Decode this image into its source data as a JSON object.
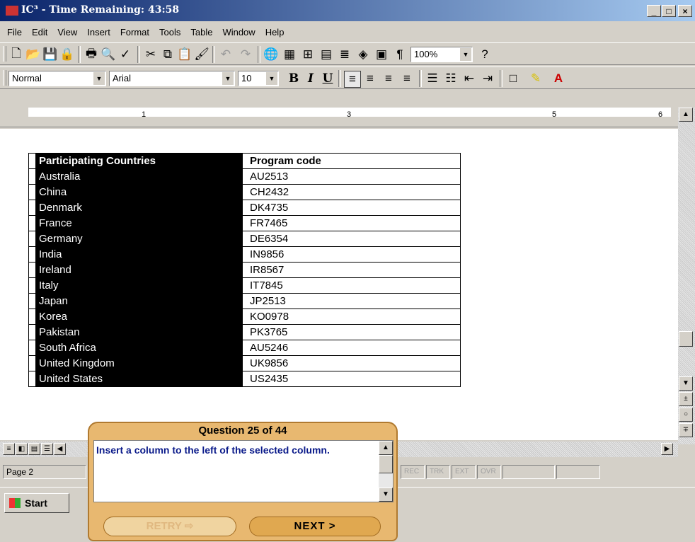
{
  "window": {
    "title": "IC³ - Time Remaining:  43:58",
    "controls": [
      "_",
      "□",
      "×"
    ]
  },
  "menu": [
    "File",
    "Edit",
    "View",
    "Insert",
    "Format",
    "Tools",
    "Table",
    "Window",
    "Help"
  ],
  "standard_toolbar": {
    "zoom": "100%"
  },
  "format_toolbar": {
    "style": "Normal",
    "font": "Arial",
    "size": "10",
    "bold": "B",
    "italic": "I",
    "underline": "U"
  },
  "ruler": {
    "numbers": [
      "1",
      "3",
      "5",
      "6"
    ]
  },
  "table": {
    "headers": [
      "Participating Countries",
      "Program code"
    ],
    "rows": [
      [
        "Australia",
        "AU2513"
      ],
      [
        "China",
        "CH2432"
      ],
      [
        "Denmark",
        "DK4735"
      ],
      [
        "France",
        "FR7465"
      ],
      [
        "Germany",
        "DE6354"
      ],
      [
        "India",
        "IN9856"
      ],
      [
        "Ireland",
        "IR8567"
      ],
      [
        "Italy",
        "IT7845"
      ],
      [
        "Japan",
        "JP2513"
      ],
      [
        "Korea",
        "KO0978"
      ],
      [
        "Pakistan",
        "PK3765"
      ],
      [
        "South Africa",
        "AU5246"
      ],
      [
        "United Kingdom",
        "UK9856"
      ],
      [
        "United States",
        "US2435"
      ]
    ]
  },
  "status": {
    "page": "Page 2",
    "indicators": [
      "REC",
      "TRK",
      "EXT",
      "OVR"
    ]
  },
  "taskbar": {
    "start": "Start"
  },
  "question": {
    "header": "Question 25 of 44",
    "text": "Insert a column to the left of the selected column.",
    "retry": "RETRY",
    "next": "NEXT >"
  }
}
